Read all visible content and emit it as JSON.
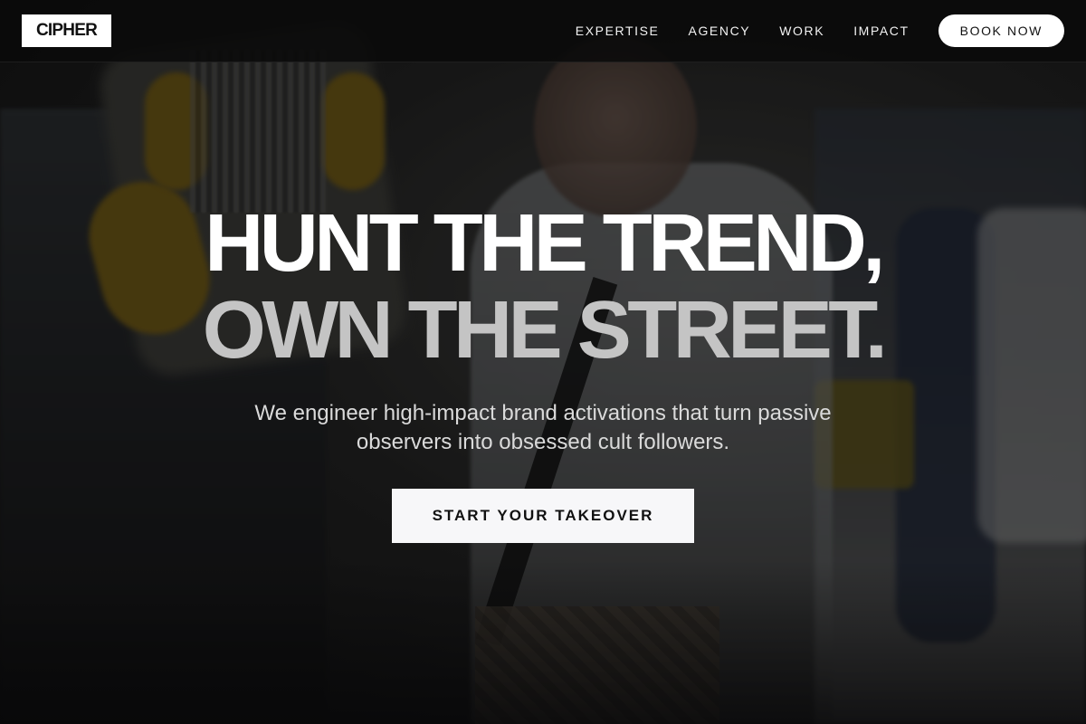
{
  "header": {
    "logo": "CIPHER",
    "nav": [
      {
        "label": "EXPERTISE"
      },
      {
        "label": "AGENCY"
      },
      {
        "label": "WORK"
      },
      {
        "label": "IMPACT"
      }
    ],
    "cta_label": "BOOK NOW"
  },
  "hero": {
    "headline_line1": "HUNT THE TREND,",
    "headline_line2": "OWN THE STREET.",
    "subheading": "We engineer high-impact brand activations that turn passive observers into obsessed cult followers.",
    "cta_label": "START YOUR TAKEOVER"
  },
  "colors": {
    "header_bg": "#0a0a0a",
    "headline_primary": "#ffffff",
    "headline_secondary": "#c4c4c4",
    "button_bg": "#ffffff"
  }
}
